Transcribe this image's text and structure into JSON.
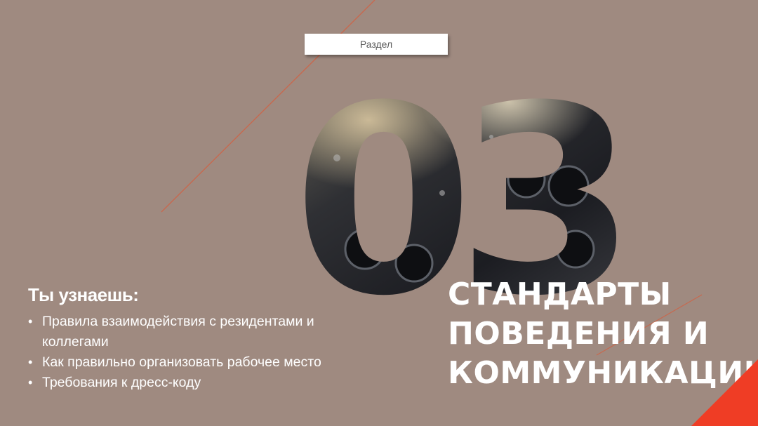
{
  "badge": {
    "label": "Раздел"
  },
  "number": {
    "text": "03"
  },
  "learn": {
    "title": "Ты узнаешь:",
    "items": [
      "Правила взаимодействия с резидентами и коллегами",
      "Как правильно организовать рабочее место",
      "Требования к дресс-коду"
    ]
  },
  "heading": {
    "line1": "СТАНДАРТЫ",
    "line2": "ПОВЕДЕНИЯ И",
    "line3": "КОММУНИКАЦИИ"
  },
  "colors": {
    "background": "#9f8a80",
    "accent": "#ef3d25",
    "line": "#c7694f",
    "text": "#ffffff"
  }
}
